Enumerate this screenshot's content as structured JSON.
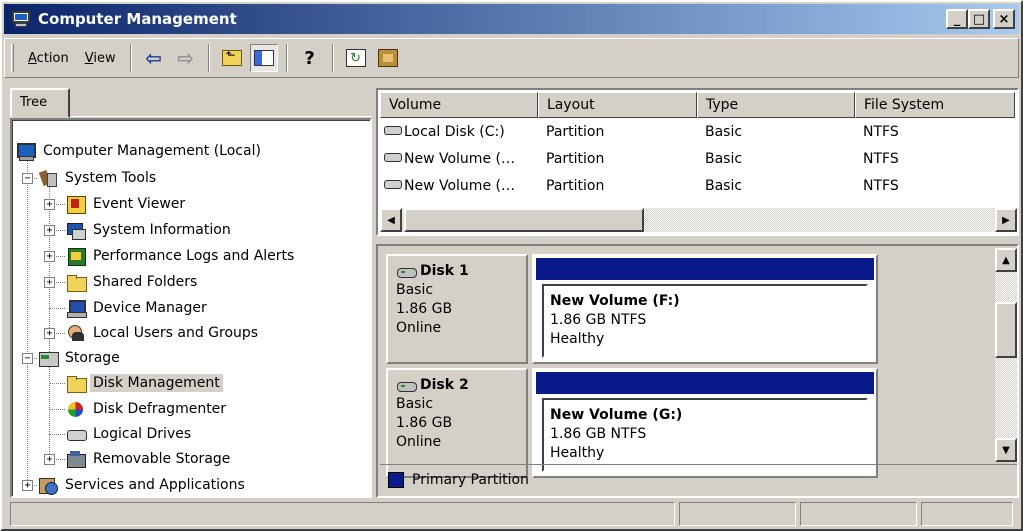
{
  "window": {
    "title": "Computer Management",
    "buttons": {
      "minimize": "_",
      "maximize": "□",
      "close": "×"
    },
    "icon": "computer-icon"
  },
  "toolbar": {
    "menus": [
      {
        "label": "Action",
        "accel": "A",
        "rest": "ction"
      },
      {
        "label": "View",
        "accel": "V",
        "rest": "iew"
      }
    ],
    "back_glyph": "⇦",
    "forward_glyph": "⇨",
    "help_glyph": "?",
    "refresh_glyph": "↻"
  },
  "tree": {
    "tab_label": "Tree",
    "nodes": [
      {
        "label": "Computer Management (Local)",
        "icon": "computer-icon"
      },
      {
        "label": "System Tools",
        "icon": "tools-icon",
        "expander": "−"
      },
      {
        "label": "Event Viewer",
        "icon": "event-viewer-icon",
        "expander": "+"
      },
      {
        "label": "System Information",
        "icon": "system-info-icon",
        "expander": "+"
      },
      {
        "label": "Performance Logs and Alerts",
        "icon": "performance-icon",
        "expander": "+"
      },
      {
        "label": "Shared Folders",
        "icon": "folder-icon",
        "expander": "+"
      },
      {
        "label": "Device Manager",
        "icon": "device-manager-icon"
      },
      {
        "label": "Local Users and Groups",
        "icon": "users-icon",
        "expander": "+"
      },
      {
        "label": "Storage",
        "icon": "storage-icon",
        "expander": "−"
      },
      {
        "label": "Disk Management",
        "icon": "folder-icon",
        "selected": true
      },
      {
        "label": "Disk Defragmenter",
        "icon": "defrag-icon"
      },
      {
        "label": "Logical Drives",
        "icon": "disk-icon"
      },
      {
        "label": "Removable Storage",
        "icon": "removable-storage-icon",
        "expander": "+"
      },
      {
        "label": "Services and Applications",
        "icon": "services-icon",
        "expander": "+"
      }
    ]
  },
  "volume_list": {
    "columns": [
      "Volume",
      "Layout",
      "Type",
      "File System"
    ],
    "rows": [
      [
        "Local Disk (C:)",
        "Partition",
        "Basic",
        "NTFS"
      ],
      [
        "New Volume (…",
        "Partition",
        "Basic",
        "NTFS"
      ],
      [
        "New Volume (…",
        "Partition",
        "Basic",
        "NTFS"
      ]
    ],
    "scroll_left": "◀",
    "scroll_right": "▶"
  },
  "disks": [
    {
      "name": "Disk 1",
      "type": "Basic",
      "size": "1.86 GB",
      "status": "Online",
      "volume": {
        "title": "New Volume  (F:)",
        "detail": "1.86 GB NTFS",
        "health": "Healthy"
      }
    },
    {
      "name": "Disk 2",
      "type": "Basic",
      "size": "1.86 GB",
      "status": "Online",
      "volume": {
        "title": "New Volume  (G:)",
        "detail": "1.86 GB NTFS",
        "health": "Healthy"
      }
    }
  ],
  "disk_scroll": {
    "up": "▲",
    "down": "▼"
  },
  "legend": {
    "label": "Primary Partition",
    "color": "#0a1a8a"
  }
}
